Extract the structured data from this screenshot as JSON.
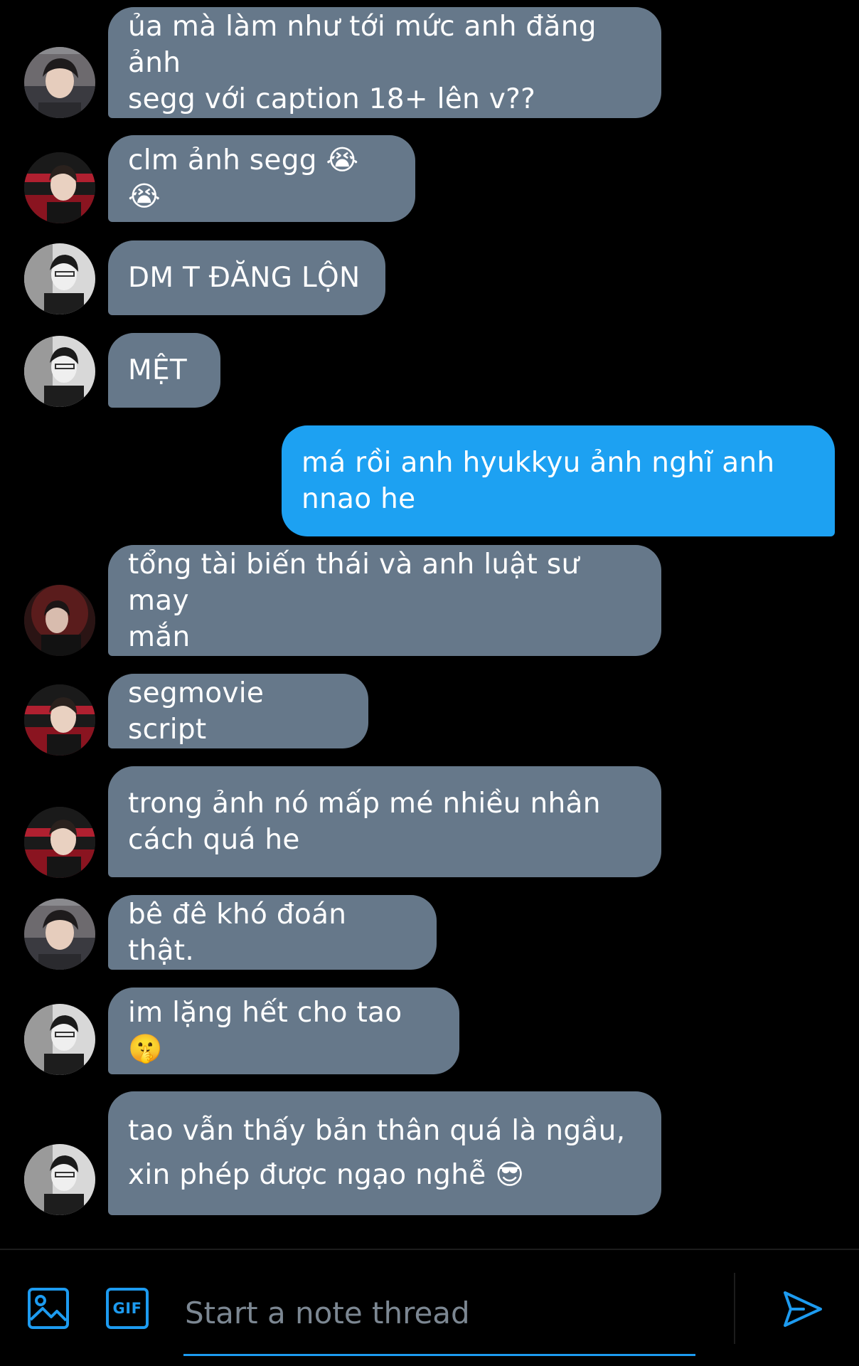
{
  "messages": [
    {
      "id": 1,
      "direction": "in",
      "text": "ủa mà làm như tới mức anh đăng ảnh\nsegg với caption 18+ lên v??",
      "avatar": "avatar-1"
    },
    {
      "id": 2,
      "direction": "in",
      "text": "clm ảnh segg 😭 😭",
      "avatar": "avatar-2"
    },
    {
      "id": 3,
      "direction": "in",
      "text": "DM T ĐĂNG LỘN",
      "avatar": "avatar-3"
    },
    {
      "id": 4,
      "direction": "in",
      "text": "MỆT",
      "avatar": "avatar-3"
    },
    {
      "id": 5,
      "direction": "out",
      "text": "má rồi anh hyukkyu ảnh nghĩ anh\nnnao he"
    },
    {
      "id": 6,
      "direction": "in",
      "text": "tổng tài biến thái và anh luật sư may\nmắn",
      "avatar": "avatar-4"
    },
    {
      "id": 7,
      "direction": "in",
      "text": "segmovie script",
      "avatar": "avatar-2"
    },
    {
      "id": 8,
      "direction": "in",
      "text": "trong ảnh nó mấp mé nhiều nhân\ncách quá he",
      "avatar": "avatar-2"
    },
    {
      "id": 9,
      "direction": "in",
      "text": "bê đê khó đoán thật.",
      "avatar": "avatar-1"
    },
    {
      "id": 10,
      "direction": "in",
      "text": "im lặng hết cho tao 🤫",
      "avatar": "avatar-3"
    },
    {
      "id": 11,
      "direction": "in",
      "text": "tao vẫn thấy bản thân quá là ngầu,\nxin phép được ngạo nghễ 😎",
      "avatar": "avatar-3"
    }
  ],
  "composer": {
    "placeholder": "Start a note thread",
    "image_icon": "image-icon",
    "gif_icon": "gif-icon",
    "gif_label": "GIF",
    "send_icon": "send-icon"
  },
  "colors": {
    "background": "#000000",
    "incoming_bubble": "#66788a",
    "outgoing_bubble": "#1da1f2",
    "accent": "#1d9bf0",
    "placeholder": "#7c8792"
  }
}
